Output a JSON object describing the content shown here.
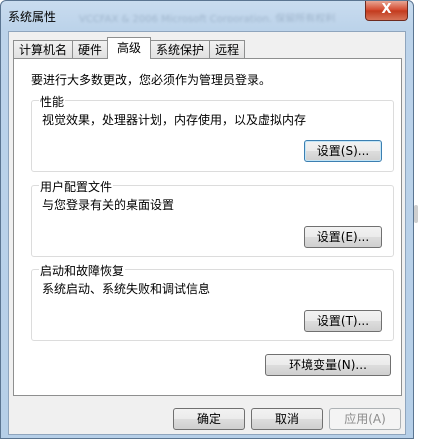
{
  "window": {
    "title": "系统属性",
    "close_glyph": "X",
    "blurred_title_text": "VCCFAX & 2006 Microsoft Corporation, 保留所有权利"
  },
  "tabs": [
    {
      "label": "计算机名",
      "active": false
    },
    {
      "label": "硬件",
      "active": false
    },
    {
      "label": "高级",
      "active": true
    },
    {
      "label": "系统保护",
      "active": false
    },
    {
      "label": "远程",
      "active": false
    }
  ],
  "notice": "要进行大多数更改，您必须作为管理员登录。",
  "performance": {
    "title": "性能",
    "description": "视觉效果，处理器计划，内存使用，以及虚拟内存",
    "button": "设置(S)..."
  },
  "user_profiles": {
    "title": "用户配置文件",
    "description": "与您登录有关的桌面设置",
    "button": "设置(E)..."
  },
  "startup_recovery": {
    "title": "启动和故障恢复",
    "description": "系统启动、系统失败和调试信息",
    "button": "设置(T)..."
  },
  "env_button": "环境变量(N)...",
  "footer": {
    "ok": "确定",
    "cancel": "取消",
    "apply": "应用(A)"
  },
  "colors": {
    "title_bar": "#bcd3ea",
    "close_button": "#d2452a",
    "client_bg": "#f0f0f0",
    "focus_border": "#3c7fb1"
  }
}
